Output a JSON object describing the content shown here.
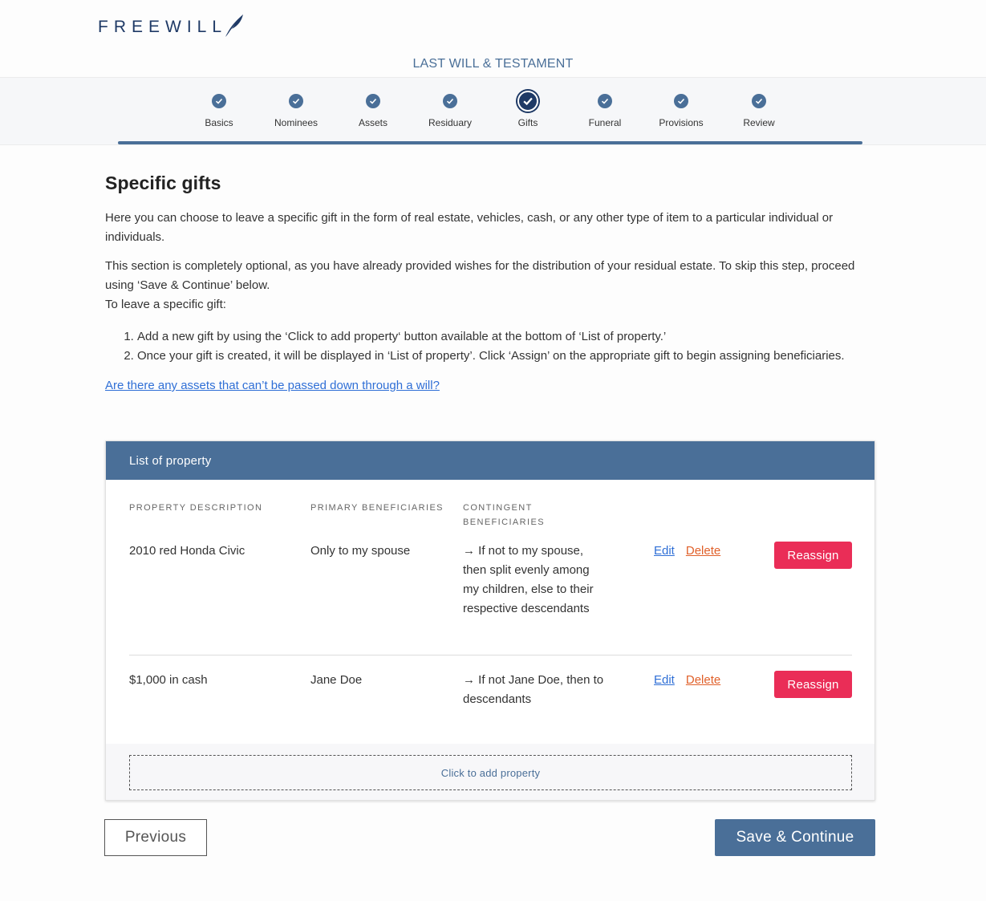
{
  "brand": {
    "logo_text": "FREEWILL"
  },
  "document": {
    "title": "LAST WILL & TESTAMENT"
  },
  "steps": [
    {
      "label": "Basics",
      "state": "complete"
    },
    {
      "label": "Nominees",
      "state": "complete"
    },
    {
      "label": "Assets",
      "state": "complete"
    },
    {
      "label": "Residuary",
      "state": "complete"
    },
    {
      "label": "Gifts",
      "state": "current"
    },
    {
      "label": "Funeral",
      "state": "complete"
    },
    {
      "label": "Provisions",
      "state": "complete"
    },
    {
      "label": "Review",
      "state": "complete"
    }
  ],
  "page": {
    "heading": "Specific gifts",
    "intro": "Here you can choose to leave a specific gift in the form of real estate, vehicles, cash, or any other type of item to a particular individual or individuals.",
    "optional_note": "This section is completely optional, as you have already provided wishes for the distribution of your residual estate. To skip this step, proceed using ‘Save & Continue’ below.",
    "instructions_lead": "To leave a specific gift:",
    "instructions": [
      "Add a new gift by using the ‘Click to add property‘ button available at the bottom of ‘List of property.’",
      "Once your gift is created, it will be displayed in ‘List of property’. Click ‘Assign’ on the appropriate gift to begin assigning beneficiaries."
    ],
    "help_link": "Are there any assets that can’t be passed down through a will?"
  },
  "property_list": {
    "title": "List of property",
    "columns": {
      "description": "PROPERTY DESCRIPTION",
      "primary": "PRIMARY BENEFICIARIES",
      "contingent": "CONTINGENT BENEFICIARIES"
    },
    "rows": [
      {
        "description": "2010 red Honda Civic",
        "primary": "Only to my spouse",
        "contingent": "→ If not to my spouse, then split evenly among my children, else to their respective descendants",
        "edit": "Edit",
        "delete": "Delete",
        "reassign": "Reassign"
      },
      {
        "description": "$1,000 in cash",
        "primary": "Jane Doe",
        "contingent": "→ If not Jane Doe, then to descendants",
        "edit": "Edit",
        "delete": "Delete",
        "reassign": "Reassign"
      }
    ],
    "add_button": "Click to add property"
  },
  "footer": {
    "previous": "Previous",
    "save": "Save & Continue"
  },
  "colors": {
    "brand_navy": "#1f3a66",
    "accent_blue": "#4a6f98",
    "link_blue": "#2f6fd6",
    "delete_orange": "#e0602a",
    "reassign_red": "#ea2d57"
  },
  "icons": {
    "step_status": "check-icon",
    "logo_mark": "quill-icon",
    "arrow": "arrow-right-icon"
  }
}
